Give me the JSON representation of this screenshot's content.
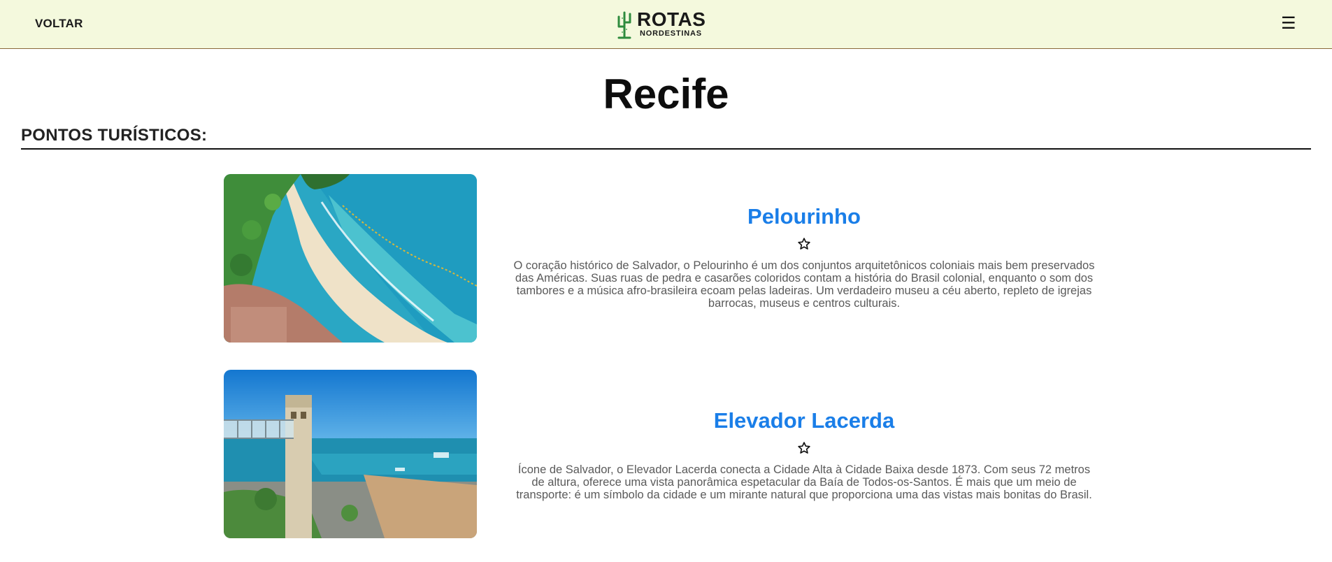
{
  "header": {
    "back_label": "VOLTAR",
    "logo_title": "ROTAS",
    "logo_subtitle": "NORDESTINAS",
    "menu_icon": "☰"
  },
  "page": {
    "title": "Recife",
    "section_title": "PONTOS TURÍSTICOS:"
  },
  "attractions": [
    {
      "title": "Pelourinho",
      "favorite_icon": "star-outline",
      "description": "O coração histórico de Salvador, o Pelourinho é um dos conjuntos arquitetônicos coloniais mais bem preservados das Américas. Suas ruas de pedra e casarões coloridos contam a história do Brasil colonial, enquanto o som dos tambores e a música afro-brasileira ecoam pelas ladeiras. Um verdadeiro museu a céu aberto, repleto de igrejas barrocas, museus e centros culturais."
    },
    {
      "title": "Elevador Lacerda",
      "favorite_icon": "star-outline",
      "description": "Ícone de Salvador, o Elevador Lacerda conecta a Cidade Alta à Cidade Baixa desde 1873. Com seus 72 metros de altura, oferece uma vista panorâmica espetacular da Baía de Todos-os-Santos. É mais que um meio de transporte: é um símbolo da cidade e um mirante natural que proporciona uma das vistas mais bonitas do Brasil."
    }
  ],
  "colors": {
    "header_bg": "#f4f9dd",
    "accent_title": "#1a7ee8",
    "logo_green": "#2e8b3d"
  }
}
